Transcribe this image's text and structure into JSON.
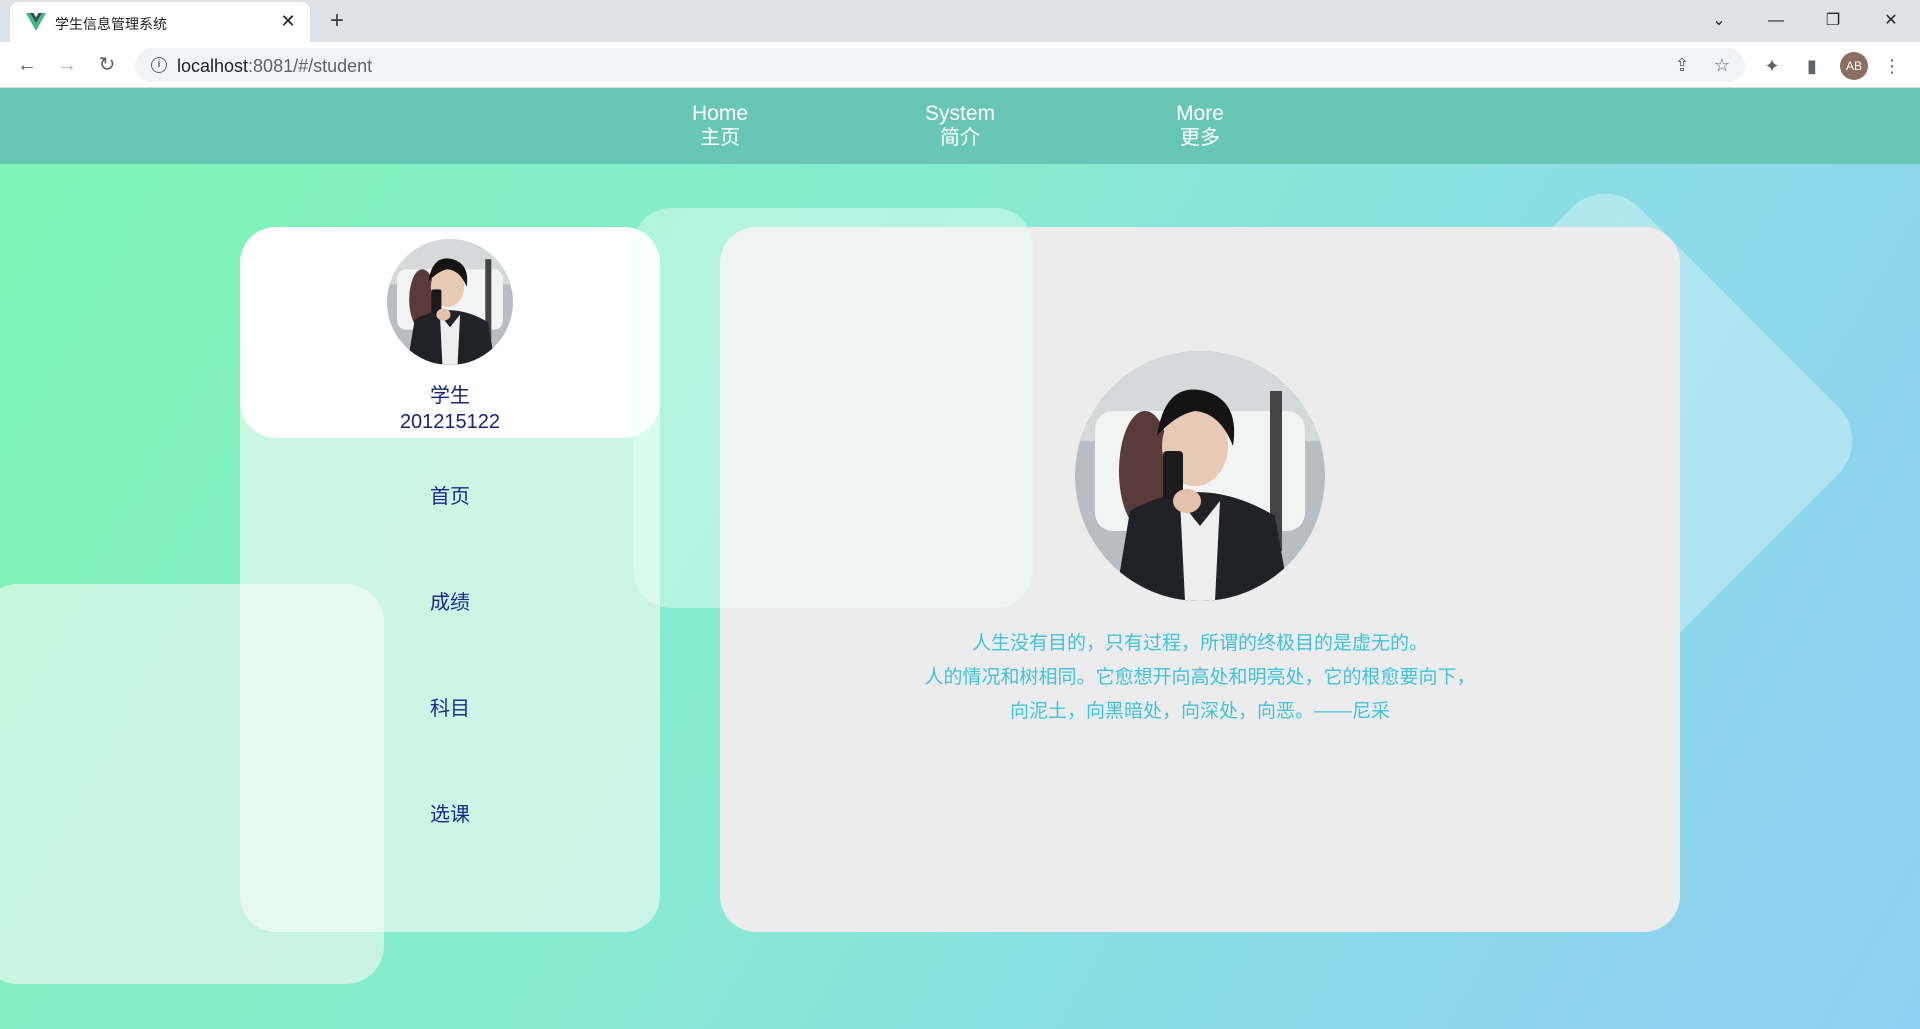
{
  "browser": {
    "tab_title": "学生信息管理系统",
    "url_host": "localhost",
    "url_path": ":8081/#/student",
    "profile_initials": "AB"
  },
  "topnav": {
    "items": [
      {
        "en": "Home",
        "zh": "主页"
      },
      {
        "en": "System",
        "zh": "简介"
      },
      {
        "en": "More",
        "zh": "更多"
      }
    ]
  },
  "profile": {
    "role": "学生",
    "student_id": "201215122"
  },
  "menu": {
    "items": [
      "首页",
      "成绩",
      "科目",
      "选课"
    ]
  },
  "main": {
    "quote_lines": [
      "人生没有目的，只有过程，所谓的终极目的是虚无的。",
      "人的情况和树相同。它愈想开向高处和明亮处，它的根愈要向下，",
      "向泥土，向黑暗处，向深处，向恶。——尼采"
    ]
  },
  "colors": {
    "nav_bg": "#68c7b4",
    "menu_text": "#1a2a8a",
    "quote_text": "#3fc3da"
  }
}
